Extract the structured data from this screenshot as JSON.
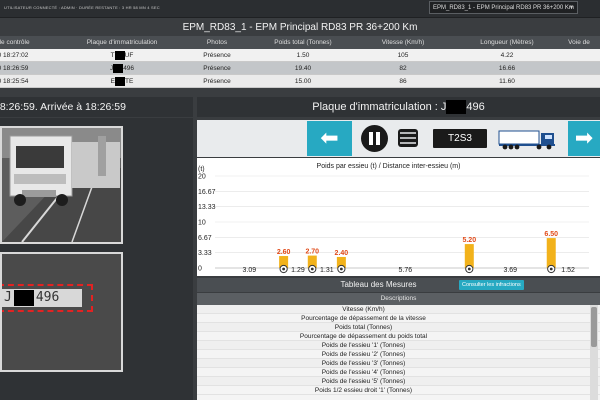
{
  "topbar": {
    "user_info": "UTILISATEUR CONNECTÉ : ADMIN · DURÉE RESTANTE : 3 HR 58 MN 4 SEC",
    "station_select": "EPM_RD83_1 - EPM Principal RD83 PR 36+200 Km"
  },
  "station_title": "EPM_RD83_1 - EPM Principal RD83 PR 36+200 Km",
  "passages": {
    "headers": [
      "e de contrôle",
      "Plaque d'immatriculation",
      "Photos",
      "Poids total (Tonnes)",
      "Vitesse (Km/h)",
      "Longueur (Mètres)",
      "Voie de"
    ],
    "rows": [
      {
        "date": "20 18:27:02",
        "plate_pre": "T",
        "plate_post": "UF",
        "photos": "Présence",
        "poids": "1.50",
        "vitesse": "105",
        "longueur": "4.22",
        "voie": ""
      },
      {
        "date": "20 18:26:59",
        "plate_pre": "J",
        "plate_post": "496",
        "photos": "Présence",
        "poids": "19.40",
        "vitesse": "82",
        "longueur": "16.66",
        "voie": ""
      },
      {
        "date": "20 18:25:54",
        "plate_pre": "E",
        "plate_post": "TE",
        "photos": "Présence",
        "poids": "15.00",
        "vitesse": "86",
        "longueur": "11.60",
        "voie": ""
      }
    ]
  },
  "left_panel": {
    "header": "18:26:59. Arrivée à 18:26:59",
    "plate_pre": "J",
    "plate_post": "496"
  },
  "right_panel": {
    "header_prefix": "Plaque d'immatriculation : J",
    "header_suffix": "496",
    "silhouette_code": "T2S3",
    "prev_icon": "arrow-left-icon",
    "next_icon": "arrow-right-icon"
  },
  "chart_data": {
    "type": "bar",
    "title": "Poids par essieu (t) / Distance inter-essieu (m)",
    "ylabel": "(t)",
    "ylim": [
      0,
      20
    ],
    "yticks": [
      "20",
      "16.67",
      "13.33",
      "10",
      "6.67",
      "3.33",
      "0"
    ],
    "axles": [
      {
        "position": 3.09,
        "value": 2.6
      },
      {
        "position": 4.38,
        "value": 2.7
      },
      {
        "position": 5.69,
        "value": 2.4
      },
      {
        "position": 11.45,
        "value": 5.2
      },
      {
        "position": 15.14,
        "value": 6.5
      }
    ],
    "distances": [
      {
        "label": "3.09",
        "at": 1.545
      },
      {
        "label": "1.29",
        "at": 3.735
      },
      {
        "label": "1.31",
        "at": 5.035
      },
      {
        "label": "5.76",
        "at": 8.57
      },
      {
        "label": "3.69",
        "at": 13.295
      },
      {
        "label": "1.52",
        "at": 15.9
      }
    ],
    "x_total": 16.66,
    "bar_color": "#f2b21b",
    "value_color": "#e14b1a"
  },
  "measures": {
    "title": "Tableau des Mesures",
    "infractions_button": "Consulter les infractions",
    "column": "Descriptions",
    "items": [
      "Vitesse (Km/h)",
      "Pourcentage de dépassement de la vitesse",
      "Poids total (Tonnes)",
      "Pourcentage de dépassement du poids total",
      "Poids de l'essieu '1' (Tonnes)",
      "Poids de l'essieu '2' (Tonnes)",
      "Poids de l'essieu '3' (Tonnes)",
      "Poids de l'essieu '4' (Tonnes)",
      "Poids de l'essieu '5' (Tonnes)",
      "Poids 1/2 essieu droit '1' (Tonnes)"
    ]
  }
}
